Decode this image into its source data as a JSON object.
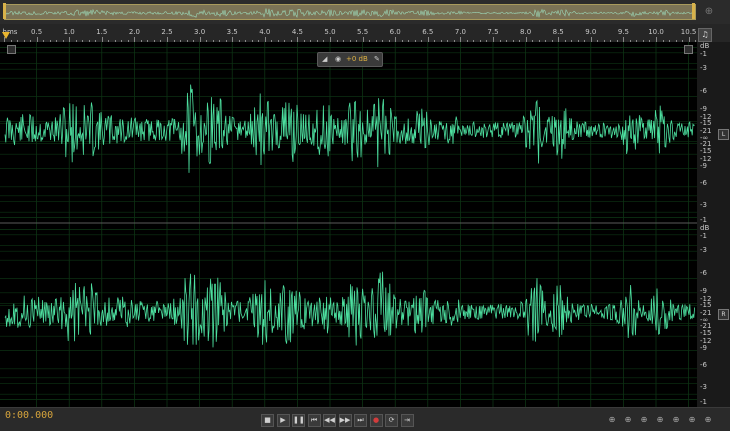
{
  "ruler": {
    "unit": "hms",
    "labels": [
      "0.5",
      "1.0",
      "1.5",
      "2.0",
      "2.5",
      "3.0",
      "3.5",
      "4.0",
      "4.5",
      "5.0",
      "5.5",
      "6.0",
      "6.5",
      "7.0",
      "7.5",
      "8.0",
      "8.5",
      "9.0",
      "9.5",
      "10.0",
      "10.5"
    ]
  },
  "hud": {
    "gain": "+0 dB"
  },
  "channels": [
    {
      "tag": "L",
      "db_unit": "dB",
      "db_labels": [
        "-1",
        "-3",
        "-6",
        "-9",
        "-12",
        "-15",
        "-21",
        "-∞",
        "-21",
        "-15",
        "-12",
        "-9",
        "-6",
        "-3",
        "-1"
      ]
    },
    {
      "tag": "R",
      "db_unit": "dB",
      "db_labels": [
        "-1",
        "-3",
        "-6",
        "-9",
        "-12",
        "-15",
        "-21",
        "-∞",
        "-21",
        "-15",
        "-12",
        "-9",
        "-6",
        "-3",
        "-1"
      ]
    }
  ],
  "transport": {
    "time": "0:00.000",
    "icons": [
      "stop-icon",
      "play-icon",
      "pause-icon",
      "move-to-start-icon",
      "rewind-icon",
      "fast-forward-icon",
      "move-to-end-icon",
      "record-icon",
      "loop-icon",
      "skip-selection-icon"
    ]
  },
  "zoom": {
    "icons": [
      "zoom-in-amplitude-icon",
      "zoom-out-amplitude-icon",
      "zoom-out-full-icon",
      "zoom-in-point-icon",
      "zoom-in-time-icon",
      "zoom-out-time-icon",
      "zoom-selection-icon"
    ]
  },
  "colors": {
    "waveform": "#4de0a0",
    "time": "#d6a43c",
    "overview": "#7b7356"
  }
}
